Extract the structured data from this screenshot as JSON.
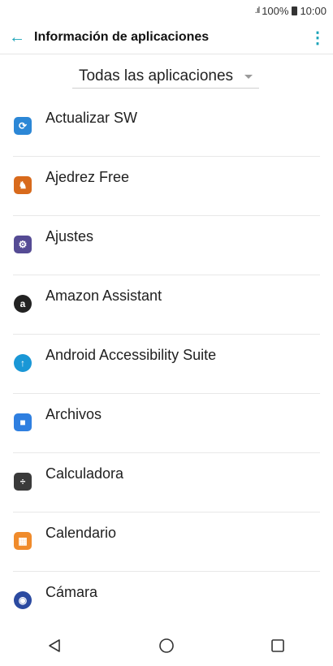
{
  "status_bar": {
    "signal": ".ıl",
    "battery": "100%",
    "time": "10:00"
  },
  "app_bar": {
    "title": "Información de aplicaciones"
  },
  "filter": {
    "selected": "Todas las aplicaciones"
  },
  "apps": [
    {
      "label": "Actualizar SW",
      "icon": "update-icon",
      "color": "#2c87d6"
    },
    {
      "label": "Ajedrez Free",
      "icon": "chess-icon",
      "color": "#d86a1c"
    },
    {
      "label": "Ajustes",
      "icon": "settings-gear-icon",
      "color": "#554b94"
    },
    {
      "label": "Amazon Assistant",
      "icon": "amazon-icon",
      "color": "#222222"
    },
    {
      "label": "Android Accessibility Suite",
      "icon": "accessibility-icon",
      "color": "#1a97d6"
    },
    {
      "label": "Archivos",
      "icon": "folder-icon",
      "color": "#2f7fe0"
    },
    {
      "label": "Calculadora",
      "icon": "calculator-icon",
      "color": "#3a3a3a"
    },
    {
      "label": "Calendario",
      "icon": "calendar-icon",
      "color": "#f08b2b"
    },
    {
      "label": "Cámara",
      "icon": "camera-icon",
      "color": "#2b4aa0"
    }
  ]
}
